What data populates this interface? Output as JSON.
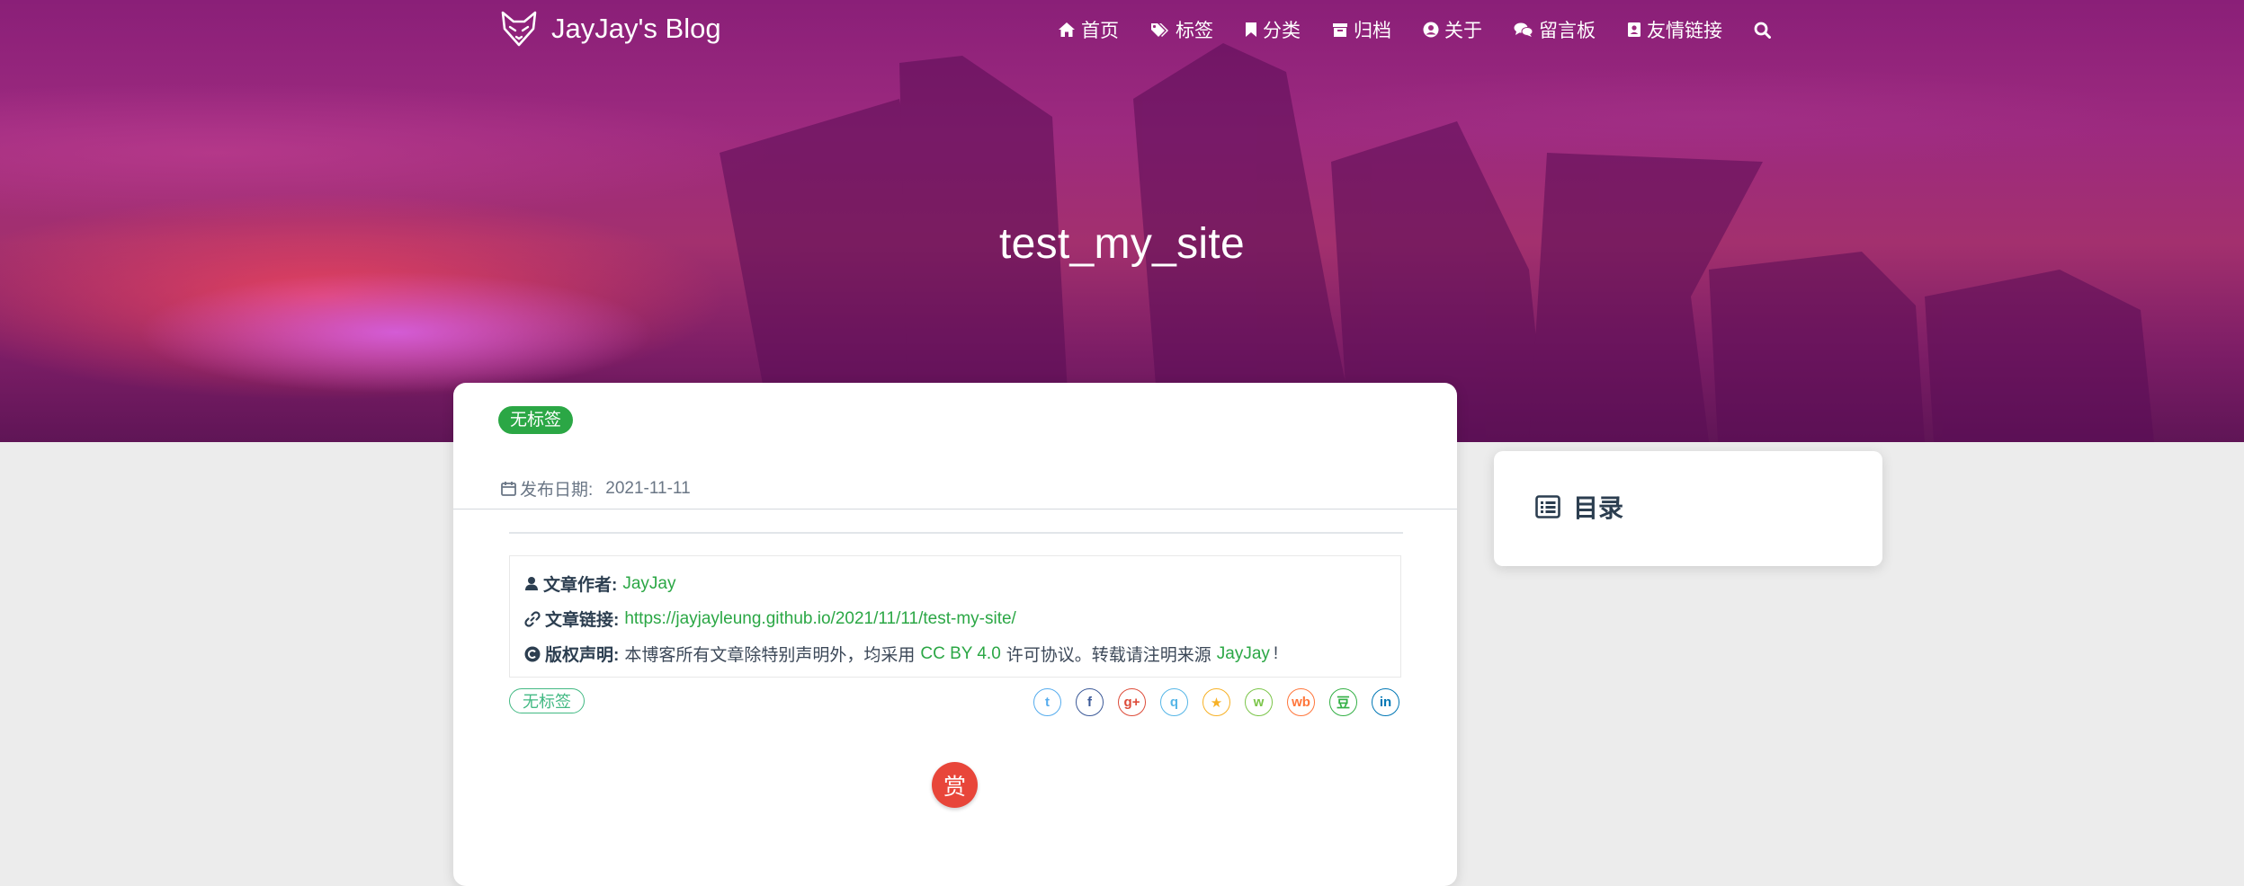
{
  "site": {
    "brand": "JayJay's Blog"
  },
  "nav": {
    "items": [
      {
        "label": "首页",
        "icon": "home-icon"
      },
      {
        "label": "标签",
        "icon": "tags-icon"
      },
      {
        "label": "分类",
        "icon": "bookmark-icon"
      },
      {
        "label": "归档",
        "icon": "archive-icon"
      },
      {
        "label": "关于",
        "icon": "user-circle-icon"
      },
      {
        "label": "留言板",
        "icon": "comments-icon"
      },
      {
        "label": "友情链接",
        "icon": "address-book-icon"
      }
    ],
    "search_icon": "search-icon"
  },
  "hero": {
    "title": "test_my_site"
  },
  "post": {
    "tag_badge": "无标签",
    "date_label": "发布日期:",
    "date": "2021-11-11",
    "copyright": {
      "author_label": "文章作者:",
      "author": "JayJay",
      "link_label": "文章链接:",
      "link": "https://jayjayleung.github.io/2021/11/11/test-my-site/",
      "license_label": "版权声明:",
      "license_prefix": "本博客所有文章除特别声明外，均采用",
      "license_name": "CC BY 4.0",
      "license_middle": "许可协议。转载请注明来源",
      "license_source": "JayJay",
      "license_end": "!"
    },
    "tag": "无标签",
    "share": [
      {
        "name": "twitter",
        "glyph": "t",
        "color": "#55acee"
      },
      {
        "name": "facebook",
        "glyph": "f",
        "color": "#3b5998"
      },
      {
        "name": "google-plus",
        "glyph": "g+",
        "color": "#dd4b39"
      },
      {
        "name": "qq",
        "glyph": "q",
        "color": "#56b6e7"
      },
      {
        "name": "qzone",
        "glyph": "★",
        "color": "#f7b125"
      },
      {
        "name": "wechat",
        "glyph": "w",
        "color": "#7bc549"
      },
      {
        "name": "weibo",
        "glyph": "wb",
        "color": "#ff763b"
      },
      {
        "name": "douban",
        "glyph": "豆",
        "color": "#33b045"
      },
      {
        "name": "linkedin",
        "glyph": "in",
        "color": "#0077b5"
      }
    ],
    "reward": "赏"
  },
  "toc": {
    "title": "目录"
  },
  "colors": {
    "accent_green": "#2ba745",
    "link_green": "#42b983",
    "reward_red": "#e8463a",
    "hero_purple": "#9d2a7f"
  }
}
